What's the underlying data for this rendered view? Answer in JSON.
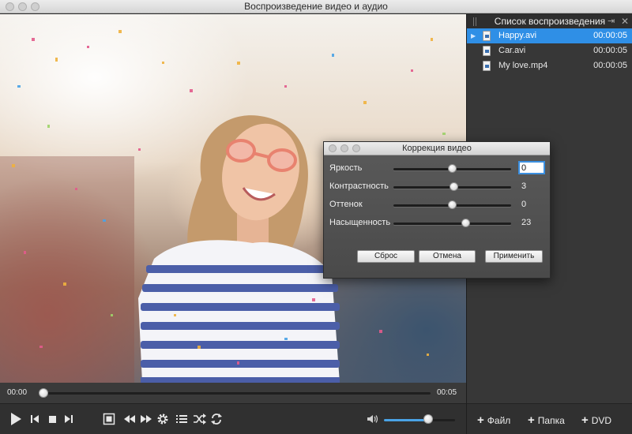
{
  "window": {
    "title": "Воспроизведение видео и аудио"
  },
  "player": {
    "current_time": "00:00",
    "total_time": "00:05",
    "progress": 0.0,
    "volume": 0.62
  },
  "controls": {
    "icons": [
      "play-icon",
      "prev-icon",
      "stop-icon",
      "next-icon",
      "fullscreen-icon",
      "rewind-icon",
      "forward-icon",
      "settings-icon",
      "playlist-icon",
      "shuffle-icon",
      "repeat-icon",
      "volume-icon"
    ]
  },
  "playlist": {
    "title": "Список воспроизведения",
    "items": [
      {
        "name": "Happy.avi",
        "duration": "00:00:05",
        "selected": true
      },
      {
        "name": "Car.avi",
        "duration": "00:00:05",
        "selected": false
      },
      {
        "name": "My love.mp4",
        "duration": "00:00:05",
        "selected": false
      }
    ],
    "footer": {
      "add_file": "Файл",
      "add_folder": "Папка",
      "add_dvd": "DVD"
    }
  },
  "dialog": {
    "title": "Коррекция видео",
    "rows": [
      {
        "label": "Яркость",
        "value": "0",
        "level": 0.5
      },
      {
        "label": "Контрастность",
        "value": "3",
        "level": 0.52
      },
      {
        "label": "Оттенок",
        "value": "0",
        "level": 0.5
      },
      {
        "label": "Насыщенность",
        "value": "23",
        "level": 0.62
      }
    ],
    "buttons": {
      "reset": "Сброс",
      "cancel": "Отмена",
      "apply": "Применить"
    }
  },
  "colors": {
    "accent": "#2f8fe6",
    "panel": "#373737",
    "dialog": "#4f4f4f"
  }
}
